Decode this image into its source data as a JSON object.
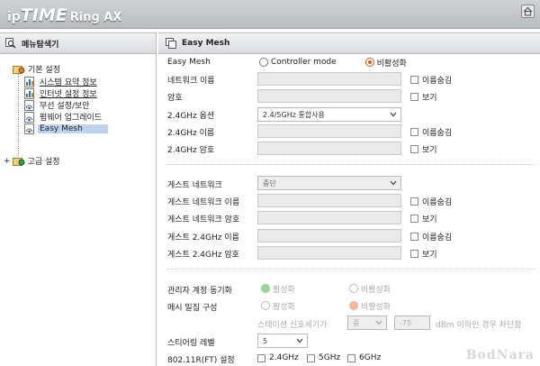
{
  "header": {
    "logo_ip": "ip",
    "logo_time": "TIME",
    "logo_model": "Ring AX",
    "home_icon": "home-icon"
  },
  "sidebar": {
    "title": "메뉴탐색기",
    "groups": [
      {
        "label": "기본 설정",
        "items": [
          {
            "label": "시스템 요약 정보",
            "underline": true
          },
          {
            "label": "인터넷 설정 정보",
            "underline": true
          },
          {
            "label": "무선 설정/보안",
            "underline": false
          },
          {
            "label": "펌웨어 업그레이드",
            "underline": false
          },
          {
            "label": "Easy Mesh",
            "underline": false,
            "selected": true
          }
        ]
      },
      {
        "label": "고급 설정",
        "items": []
      }
    ]
  },
  "main": {
    "title": "Easy Mesh",
    "easy_mesh": {
      "label": "Easy Mesh",
      "option_controller": "Controller mode",
      "option_disabled": "비활성화",
      "selected": "비활성화"
    },
    "wifi": {
      "network_name_label": "네트워크 이름",
      "hide_name_label": "이름숨김",
      "password_label": "암호",
      "show_label": "보기",
      "band_option_label": "2.4GHz 옵션",
      "band_option_value": "2.4/5GHz 통합사용",
      "name24_label": "2.4GHz 이름",
      "pass24_label": "2.4GHz 암호"
    },
    "guest": {
      "network_label": "게스트 네트워크",
      "network_value": "중단",
      "name_label": "게스트 네트워크 이름",
      "pass_label": "게스트 네트워크 암호",
      "name24_label": "게스트 2.4GHz 이름",
      "pass24_label": "게스트 2.4GHz 암호"
    },
    "admin_sync": {
      "label": "관리자 계정 동기화",
      "on": "활성화",
      "off": "비활성화"
    },
    "mesh_density": {
      "label": "메시 밀집 구성",
      "on": "활성화",
      "off": "비활성화",
      "station_signal_label": "스테이션 신호세기가",
      "station_signal_value": "중",
      "dbm_value": "-75",
      "dbm_suffix": "dBm 이하인 경우 차단함"
    },
    "steering": {
      "label": "스티어링 레벨",
      "value": "5"
    },
    "ft": {
      "label": "802.11R(FT) 설정",
      "opt1": "2.4GHz",
      "opt2": "5GHz",
      "opt3": "6GHz"
    }
  },
  "watermark": "BodNara",
  "colors": {
    "accent_orange": "#e0561c",
    "active_green": "#9bd89b",
    "header_gray": "#c3c7cb",
    "selection_blue": "#bcd3ee"
  }
}
